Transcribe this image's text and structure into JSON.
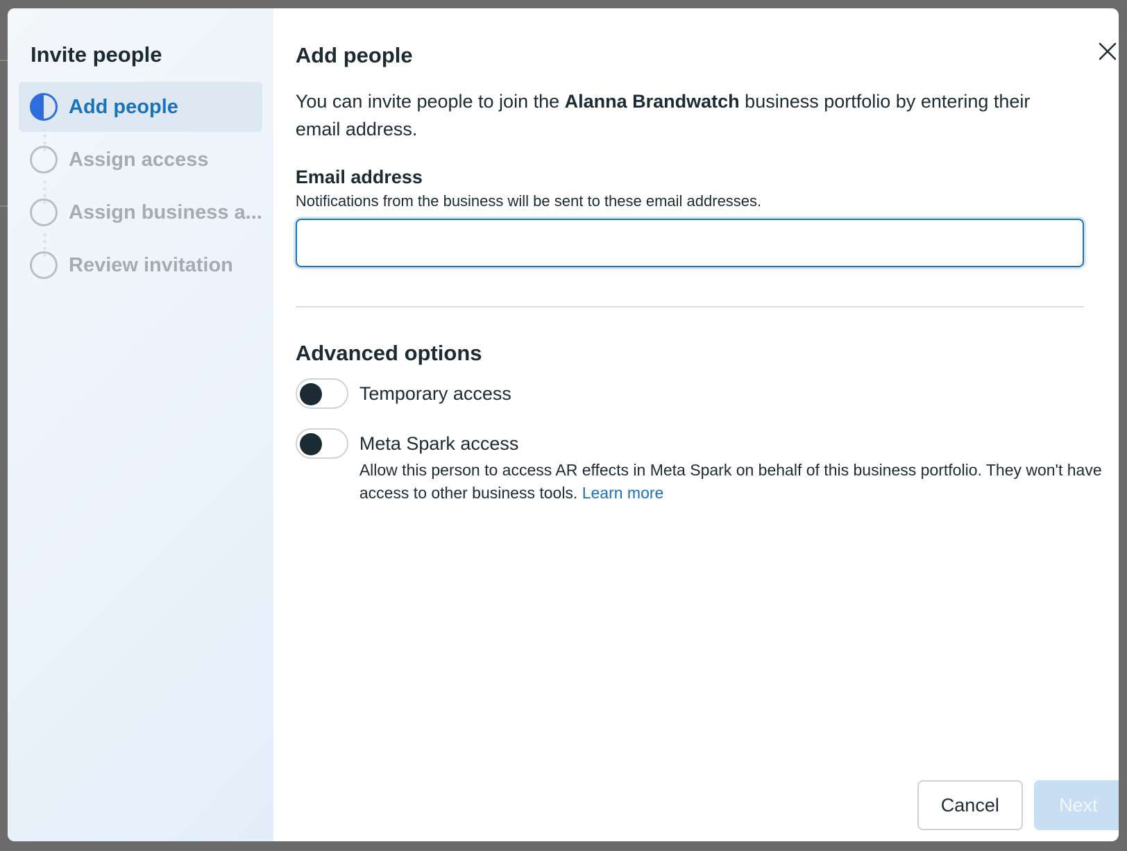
{
  "sidebar": {
    "title": "Invite people",
    "steps": [
      {
        "label": "Add people",
        "state": "active"
      },
      {
        "label": "Assign access",
        "state": "pending"
      },
      {
        "label": "Assign business a...",
        "state": "pending"
      },
      {
        "label": "Review invitation",
        "state": "pending"
      }
    ]
  },
  "main": {
    "title": "Add people",
    "intro_prefix": "You can invite people to join the ",
    "intro_business": "Alanna Brandwatch",
    "intro_suffix": " business portfolio by entering their email address.",
    "email": {
      "label": "Email address",
      "hint": "Notifications from the business will be sent to these email addresses.",
      "value": "",
      "placeholder": ""
    },
    "advanced": {
      "title": "Advanced options",
      "temporary": {
        "label": "Temporary access",
        "enabled": false
      },
      "spark": {
        "label": "Meta Spark access",
        "enabled": false,
        "description": "Allow this person to access AR effects in Meta Spark on behalf of this business portfolio. They won't have access to other business tools.",
        "link": "Learn more"
      }
    }
  },
  "footer": {
    "cancel_label": "Cancel",
    "next_label": "Next",
    "next_enabled": false
  },
  "colors": {
    "accent": "#1a73b8",
    "step_active_fill": "#2d6dde",
    "next_disabled_bg": "#c8dff3"
  },
  "icons": {
    "close": "close-icon"
  }
}
